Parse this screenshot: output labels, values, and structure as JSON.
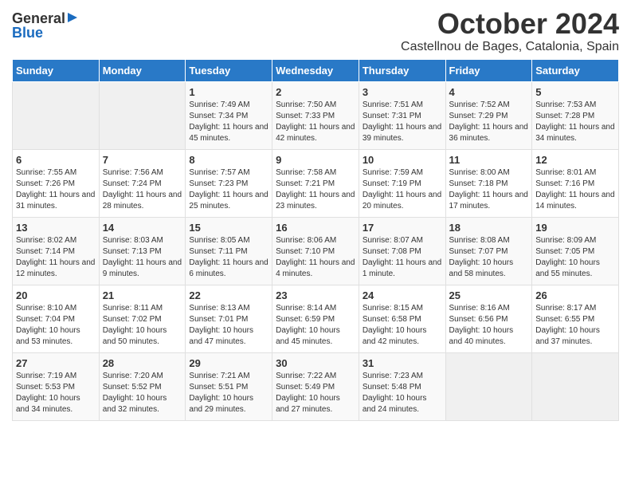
{
  "header": {
    "logo_general": "General",
    "logo_blue": "Blue",
    "month_title": "October 2024",
    "subtitle": "Castellnou de Bages, Catalonia, Spain"
  },
  "weekdays": [
    "Sunday",
    "Monday",
    "Tuesday",
    "Wednesday",
    "Thursday",
    "Friday",
    "Saturday"
  ],
  "weeks": [
    [
      {
        "date": "",
        "info": ""
      },
      {
        "date": "",
        "info": ""
      },
      {
        "date": "1",
        "info": "Sunrise: 7:49 AM\nSunset: 7:34 PM\nDaylight: 11 hours and 45 minutes."
      },
      {
        "date": "2",
        "info": "Sunrise: 7:50 AM\nSunset: 7:33 PM\nDaylight: 11 hours and 42 minutes."
      },
      {
        "date": "3",
        "info": "Sunrise: 7:51 AM\nSunset: 7:31 PM\nDaylight: 11 hours and 39 minutes."
      },
      {
        "date": "4",
        "info": "Sunrise: 7:52 AM\nSunset: 7:29 PM\nDaylight: 11 hours and 36 minutes."
      },
      {
        "date": "5",
        "info": "Sunrise: 7:53 AM\nSunset: 7:28 PM\nDaylight: 11 hours and 34 minutes."
      }
    ],
    [
      {
        "date": "6",
        "info": "Sunrise: 7:55 AM\nSunset: 7:26 PM\nDaylight: 11 hours and 31 minutes."
      },
      {
        "date": "7",
        "info": "Sunrise: 7:56 AM\nSunset: 7:24 PM\nDaylight: 11 hours and 28 minutes."
      },
      {
        "date": "8",
        "info": "Sunrise: 7:57 AM\nSunset: 7:23 PM\nDaylight: 11 hours and 25 minutes."
      },
      {
        "date": "9",
        "info": "Sunrise: 7:58 AM\nSunset: 7:21 PM\nDaylight: 11 hours and 23 minutes."
      },
      {
        "date": "10",
        "info": "Sunrise: 7:59 AM\nSunset: 7:19 PM\nDaylight: 11 hours and 20 minutes."
      },
      {
        "date": "11",
        "info": "Sunrise: 8:00 AM\nSunset: 7:18 PM\nDaylight: 11 hours and 17 minutes."
      },
      {
        "date": "12",
        "info": "Sunrise: 8:01 AM\nSunset: 7:16 PM\nDaylight: 11 hours and 14 minutes."
      }
    ],
    [
      {
        "date": "13",
        "info": "Sunrise: 8:02 AM\nSunset: 7:14 PM\nDaylight: 11 hours and 12 minutes."
      },
      {
        "date": "14",
        "info": "Sunrise: 8:03 AM\nSunset: 7:13 PM\nDaylight: 11 hours and 9 minutes."
      },
      {
        "date": "15",
        "info": "Sunrise: 8:05 AM\nSunset: 7:11 PM\nDaylight: 11 hours and 6 minutes."
      },
      {
        "date": "16",
        "info": "Sunrise: 8:06 AM\nSunset: 7:10 PM\nDaylight: 11 hours and 4 minutes."
      },
      {
        "date": "17",
        "info": "Sunrise: 8:07 AM\nSunset: 7:08 PM\nDaylight: 11 hours and 1 minute."
      },
      {
        "date": "18",
        "info": "Sunrise: 8:08 AM\nSunset: 7:07 PM\nDaylight: 10 hours and 58 minutes."
      },
      {
        "date": "19",
        "info": "Sunrise: 8:09 AM\nSunset: 7:05 PM\nDaylight: 10 hours and 55 minutes."
      }
    ],
    [
      {
        "date": "20",
        "info": "Sunrise: 8:10 AM\nSunset: 7:04 PM\nDaylight: 10 hours and 53 minutes."
      },
      {
        "date": "21",
        "info": "Sunrise: 8:11 AM\nSunset: 7:02 PM\nDaylight: 10 hours and 50 minutes."
      },
      {
        "date": "22",
        "info": "Sunrise: 8:13 AM\nSunset: 7:01 PM\nDaylight: 10 hours and 47 minutes."
      },
      {
        "date": "23",
        "info": "Sunrise: 8:14 AM\nSunset: 6:59 PM\nDaylight: 10 hours and 45 minutes."
      },
      {
        "date": "24",
        "info": "Sunrise: 8:15 AM\nSunset: 6:58 PM\nDaylight: 10 hours and 42 minutes."
      },
      {
        "date": "25",
        "info": "Sunrise: 8:16 AM\nSunset: 6:56 PM\nDaylight: 10 hours and 40 minutes."
      },
      {
        "date": "26",
        "info": "Sunrise: 8:17 AM\nSunset: 6:55 PM\nDaylight: 10 hours and 37 minutes."
      }
    ],
    [
      {
        "date": "27",
        "info": "Sunrise: 7:19 AM\nSunset: 5:53 PM\nDaylight: 10 hours and 34 minutes."
      },
      {
        "date": "28",
        "info": "Sunrise: 7:20 AM\nSunset: 5:52 PM\nDaylight: 10 hours and 32 minutes."
      },
      {
        "date": "29",
        "info": "Sunrise: 7:21 AM\nSunset: 5:51 PM\nDaylight: 10 hours and 29 minutes."
      },
      {
        "date": "30",
        "info": "Sunrise: 7:22 AM\nSunset: 5:49 PM\nDaylight: 10 hours and 27 minutes."
      },
      {
        "date": "31",
        "info": "Sunrise: 7:23 AM\nSunset: 5:48 PM\nDaylight: 10 hours and 24 minutes."
      },
      {
        "date": "",
        "info": ""
      },
      {
        "date": "",
        "info": ""
      }
    ]
  ]
}
